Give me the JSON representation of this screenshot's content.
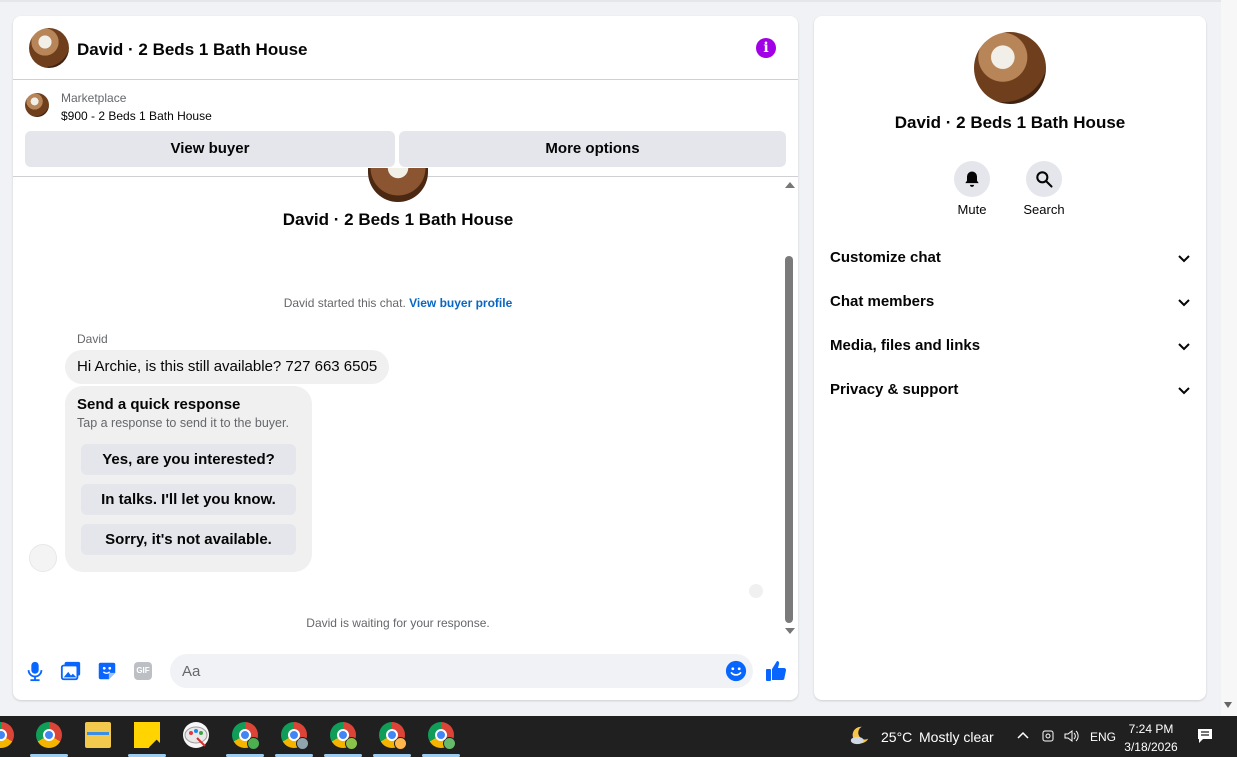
{
  "conversation": {
    "title": "David · 2 Beds 1 Bath House",
    "listing_source": "Marketplace",
    "listing_price": "$900 - 2 Beds 1 Bath House",
    "view_buyer_label": "View buyer",
    "more_options_label": "More options",
    "started_text": "David started this chat.",
    "view_profile_link": "View buyer profile",
    "sender_name": "David",
    "incoming_message": "Hi Archie, is this still available? 727 663 6505",
    "quick_response": {
      "title": "Send a quick response",
      "subtitle": "Tap a response to send it to the buyer.",
      "options": [
        "Yes, are you interested?",
        "In talks. I'll let you know.",
        "Sorry, it's not available."
      ]
    },
    "waiting_text": "David is waiting for your response.",
    "composer_placeholder": "Aa"
  },
  "info_panel": {
    "name": "David · 2 Beds 1 Bath House",
    "mute_label": "Mute",
    "search_label": "Search",
    "sections": [
      "Customize chat",
      "Chat members",
      "Media, files and links",
      "Privacy & support"
    ]
  },
  "taskbar": {
    "temperature": "25°C",
    "weather": "Mostly clear",
    "language": "ENG",
    "time": "7:24 PM",
    "date": "3/18/2026"
  },
  "colors": {
    "accent_blue": "#0866ff",
    "info_purple": "#a100e6",
    "link_blue": "#0a66c2"
  }
}
